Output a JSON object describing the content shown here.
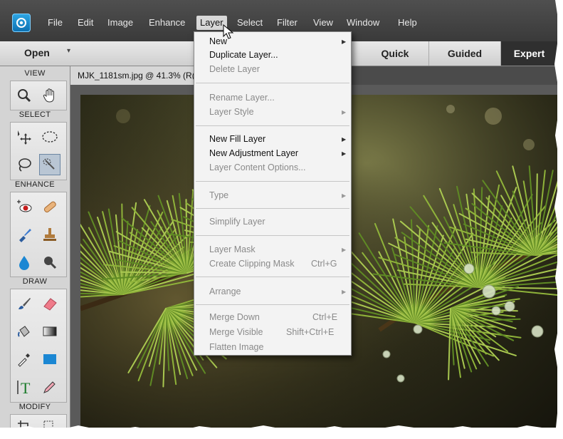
{
  "menubar": {
    "items": [
      "File",
      "Edit",
      "Image",
      "Enhance",
      "Layer",
      "Select",
      "Filter",
      "View",
      "Window",
      "Help"
    ],
    "active": "Layer"
  },
  "toolbar": {
    "open_label": "Open",
    "modes": {
      "quick": "Quick",
      "guided": "Guided",
      "expert": "Expert"
    },
    "active_mode": "Expert"
  },
  "toolpanel": {
    "sections": {
      "view": "VIEW",
      "select": "SELECT",
      "enhance": "ENHANCE",
      "draw": "DRAW",
      "modify": "MODIFY"
    },
    "tools": [
      "zoom-icon",
      "hand-icon",
      "move-icon",
      "marquee-icon",
      "lasso-icon",
      "quick-selection-icon",
      "red-eye-icon",
      "healing-brush-icon",
      "smart-brush-icon",
      "clone-stamp-icon",
      "blur-icon",
      "sponge-icon",
      "brush-icon",
      "eraser-icon",
      "paint-bucket-icon",
      "gradient-icon",
      "eyedropper-icon",
      "shape-icon",
      "type-icon",
      "pencil-icon",
      "crop-icon",
      "recompose-icon"
    ]
  },
  "document": {
    "tab_title": "MJK_1181sm.jpg @ 41.3% (R("
  },
  "layer_menu": {
    "items": [
      {
        "label": "New",
        "enabled": true,
        "submenu": true,
        "shortcut": ""
      },
      {
        "label": "Duplicate Layer...",
        "enabled": true,
        "submenu": false,
        "shortcut": ""
      },
      {
        "label": "Delete Layer",
        "enabled": false,
        "submenu": false,
        "shortcut": ""
      },
      {
        "label": "Rename Layer...",
        "enabled": false,
        "submenu": false,
        "shortcut": ""
      },
      {
        "label": "Layer Style",
        "enabled": false,
        "submenu": true,
        "shortcut": ""
      },
      {
        "label": "New Fill Layer",
        "enabled": true,
        "submenu": true,
        "shortcut": ""
      },
      {
        "label": "New Adjustment Layer",
        "enabled": true,
        "submenu": true,
        "shortcut": ""
      },
      {
        "label": "Layer Content Options...",
        "enabled": false,
        "submenu": false,
        "shortcut": ""
      },
      {
        "label": "Type",
        "enabled": false,
        "submenu": true,
        "shortcut": ""
      },
      {
        "label": "Simplify Layer",
        "enabled": false,
        "submenu": false,
        "shortcut": ""
      },
      {
        "label": "Layer Mask",
        "enabled": false,
        "submenu": true,
        "shortcut": ""
      },
      {
        "label": "Create Clipping Mask",
        "enabled": false,
        "submenu": false,
        "shortcut": "Ctrl+G"
      },
      {
        "label": "Arrange",
        "enabled": false,
        "submenu": true,
        "shortcut": ""
      },
      {
        "label": "Merge Down",
        "enabled": false,
        "submenu": false,
        "shortcut": "Ctrl+E"
      },
      {
        "label": "Merge Visible",
        "enabled": false,
        "submenu": false,
        "shortcut": "Shift+Ctrl+E"
      },
      {
        "label": "Flatten Image",
        "enabled": false,
        "submenu": false,
        "shortcut": ""
      }
    ]
  },
  "colors": {
    "menubar": "#3f3f3f",
    "active_mode": "#2f2f2f",
    "menu_bg": "#f3f3f3",
    "disabled_text": "#8a8a8a",
    "logo": "#1b8fd4"
  }
}
